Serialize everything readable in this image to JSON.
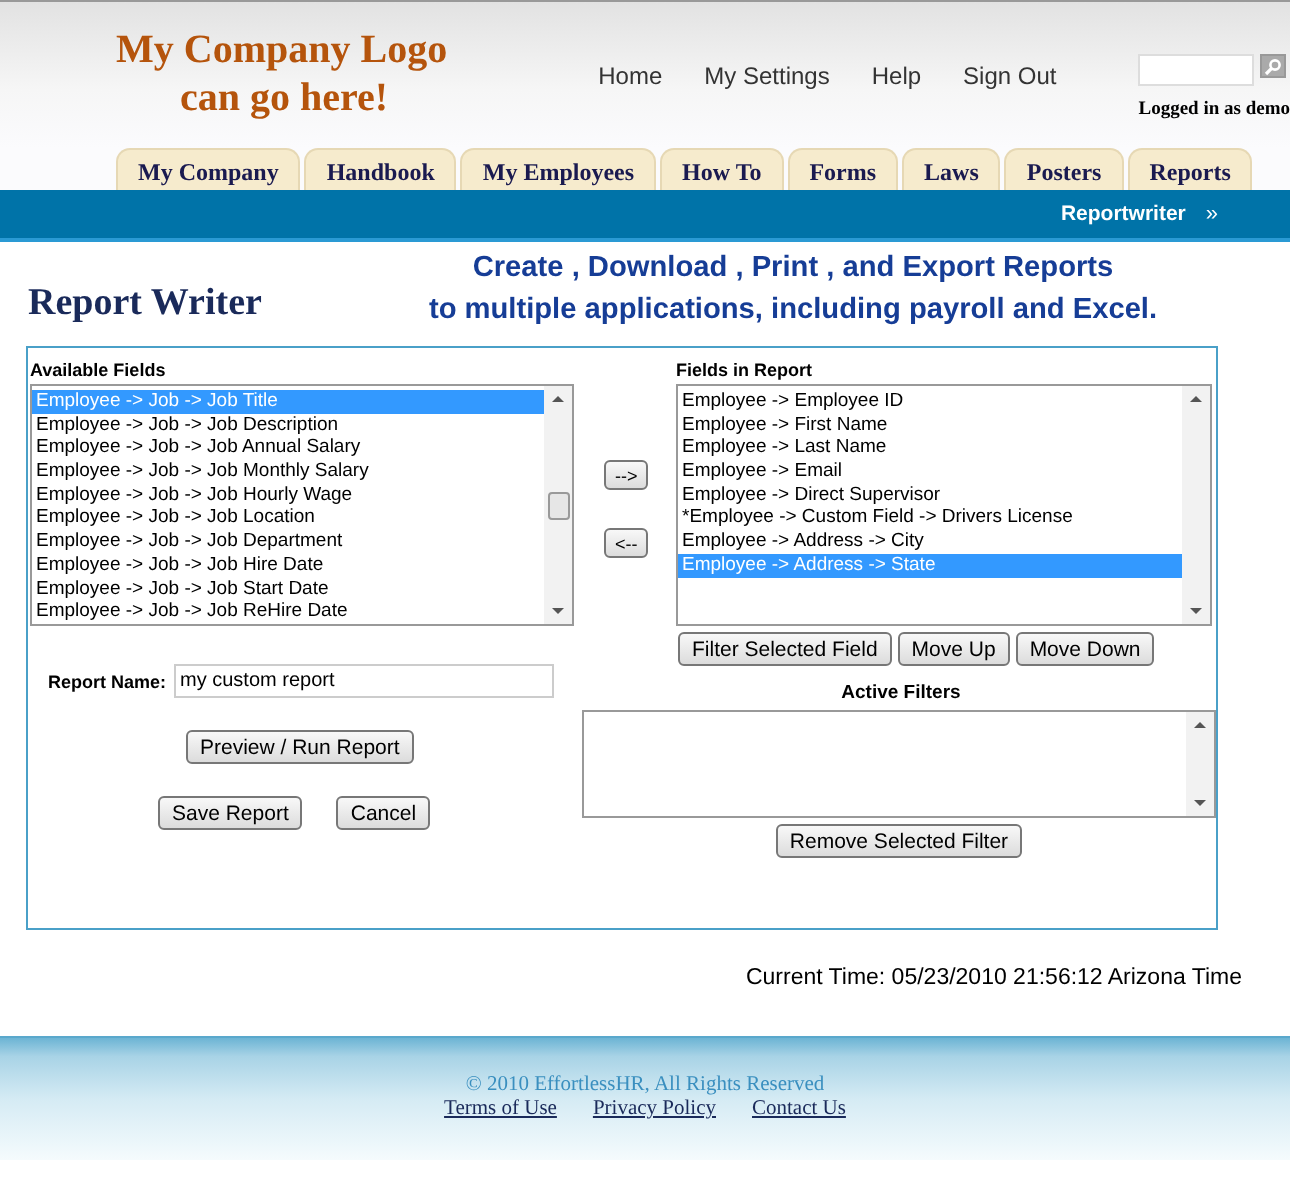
{
  "logo": {
    "lines": [
      "My Company Logo",
      "can go here!"
    ]
  },
  "nav": [
    "Home",
    "My Settings",
    "Help",
    "Sign Out"
  ],
  "login_status": "Logged in as demo",
  "tabs": [
    {
      "label": "My Company",
      "selected": false
    },
    {
      "label": "Handbook",
      "selected": false
    },
    {
      "label": "My Employees",
      "selected": false
    },
    {
      "label": "How To",
      "selected": false
    },
    {
      "label": "Forms",
      "selected": false
    },
    {
      "label": "Laws",
      "selected": false
    },
    {
      "label": "Posters",
      "selected": false
    },
    {
      "label": "Reports",
      "selected": false
    }
  ],
  "breadcrumb": {
    "label": "Reportwriter",
    "arrow": "»"
  },
  "page_title": "Report Writer",
  "headline": [
    "Create , Download , Print , and Export Reports",
    "to multiple applications, including payroll and Excel."
  ],
  "available_fields": {
    "label": "Available Fields",
    "items": [
      {
        "text": "Employee -> Job -> Job Title",
        "selected": true
      },
      {
        "text": "Employee -> Job -> Job Description",
        "selected": false
      },
      {
        "text": "Employee -> Job -> Job Annual Salary",
        "selected": false
      },
      {
        "text": "Employee -> Job -> Job Monthly Salary",
        "selected": false
      },
      {
        "text": "Employee -> Job -> Job Hourly Wage",
        "selected": false
      },
      {
        "text": "Employee -> Job -> Job Location",
        "selected": false
      },
      {
        "text": "Employee -> Job -> Job Department",
        "selected": false
      },
      {
        "text": "Employee -> Job -> Job Hire Date",
        "selected": false
      },
      {
        "text": "Employee -> Job -> Job Start Date",
        "selected": false
      },
      {
        "text": "Employee -> Job -> Job ReHire Date",
        "selected": false
      }
    ]
  },
  "move_buttons": [
    "-->",
    "<--"
  ],
  "report_fields": {
    "label": "Fields in Report",
    "items": [
      {
        "text": "Employee -> Employee ID",
        "selected": false
      },
      {
        "text": "Employee -> First Name",
        "selected": false
      },
      {
        "text": "Employee -> Last Name",
        "selected": false
      },
      {
        "text": "Employee -> Email",
        "selected": false
      },
      {
        "text": "Employee -> Direct Supervisor",
        "selected": false
      },
      {
        "text": "*Employee -> Custom Field -> Drivers License",
        "selected": false
      },
      {
        "text": "Employee -> Address -> City",
        "selected": false
      },
      {
        "text": "Employee -> Address -> State",
        "selected": true
      }
    ]
  },
  "field_buttons": [
    "Filter Selected Field",
    "Move Up",
    "Move Down"
  ],
  "report_name": {
    "label": "Report Name:",
    "value": "my custom report"
  },
  "preview_button": "Preview / Run Report",
  "action_buttons": [
    "Save Report",
    "Cancel"
  ],
  "active_filters": {
    "label": "Active Filters"
  },
  "remove_filter_button": "Remove Selected Filter",
  "current_time": "Current Time: 05/23/2010 21:56:12 Arizona Time",
  "footer": {
    "copyright": "© 2010 EffortlessHR, All Rights Reserved",
    "links": [
      "Terms of Use",
      "Privacy Policy",
      "Contact Us"
    ]
  }
}
